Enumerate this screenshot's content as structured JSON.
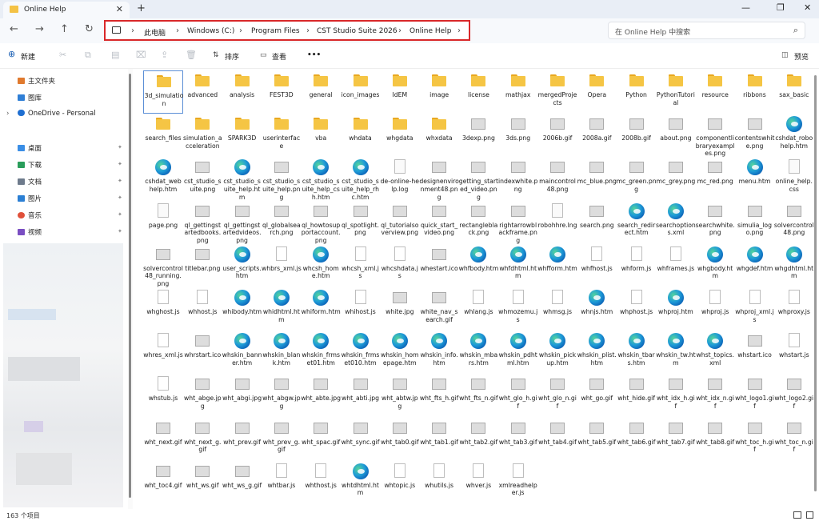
{
  "window": {
    "tab_title": "Online Help",
    "tab_close": "✕",
    "new_tab": "+",
    "minimize": "—",
    "maximize": "❐",
    "close": "✕"
  },
  "nav": {
    "back": "←",
    "forward": "→",
    "up": "↑",
    "refresh": "↻",
    "breadcrumb": [
      "此电脑",
      "Windows (C:)",
      "Program Files",
      "CST Studio Suite 2026",
      "Online Help"
    ],
    "separator": "›",
    "search_placeholder": "在 Online Help 中搜索",
    "search_icon": "⌕"
  },
  "toolbar": {
    "new_label": "新建",
    "sort_label": "排序",
    "view_label": "查看",
    "more_label": "•••",
    "preview_label": "预览"
  },
  "sidebar": {
    "items": [
      {
        "label": "主文件夹",
        "icon": "home-icon",
        "color": "#e07a2e"
      },
      {
        "label": "图库",
        "icon": "gallery-icon",
        "color": "#2f7fd6"
      },
      {
        "label": "OneDrive - Personal",
        "icon": "cloud-icon",
        "color": "#1f6fd1"
      },
      {
        "label": "桌面",
        "icon": "desktop-icon",
        "color": "#3a8ee6"
      },
      {
        "label": "下载",
        "icon": "download-icon",
        "color": "#2a9d5b"
      },
      {
        "label": "文档",
        "icon": "documents-icon",
        "color": "#6e7b8c"
      },
      {
        "label": "图片",
        "icon": "pictures-icon",
        "color": "#2b7fd4"
      },
      {
        "label": "音乐",
        "icon": "music-icon",
        "color": "#e0503a"
      },
      {
        "label": "视频",
        "icon": "video-icon",
        "color": "#7a4ec2"
      }
    ],
    "pin_glyph": "📌"
  },
  "files": [
    {
      "name": "3d_simulation",
      "type": "folder"
    },
    {
      "name": "advanced",
      "type": "folder"
    },
    {
      "name": "analysis",
      "type": "folder"
    },
    {
      "name": "FEST3D",
      "type": "folder"
    },
    {
      "name": "general",
      "type": "folder"
    },
    {
      "name": "icon_images",
      "type": "folder"
    },
    {
      "name": "IdEM",
      "type": "folder"
    },
    {
      "name": "image",
      "type": "folder"
    },
    {
      "name": "license",
      "type": "folder"
    },
    {
      "name": "mathjax",
      "type": "folder"
    },
    {
      "name": "mergedProjects",
      "type": "folder"
    },
    {
      "name": "Opera",
      "type": "folder"
    },
    {
      "name": "Python",
      "type": "folder"
    },
    {
      "name": "PythonTutorial",
      "type": "folder"
    },
    {
      "name": "resource",
      "type": "folder"
    },
    {
      "name": "ribbons",
      "type": "folder"
    },
    {
      "name": "sax_basic",
      "type": "folder"
    },
    {
      "name": "search_files",
      "type": "folder"
    },
    {
      "name": "simulation_acceleration",
      "type": "folder"
    },
    {
      "name": "SPARK3D",
      "type": "folder"
    },
    {
      "name": "userinterface",
      "type": "folder"
    },
    {
      "name": "vba",
      "type": "folder"
    },
    {
      "name": "whdata",
      "type": "folder"
    },
    {
      "name": "whgdata",
      "type": "folder"
    },
    {
      "name": "whxdata",
      "type": "folder"
    },
    {
      "name": "3dexp.png",
      "type": "img"
    },
    {
      "name": "3ds.png",
      "type": "img"
    },
    {
      "name": "2006b.gif",
      "type": "img"
    },
    {
      "name": "2008a.gif",
      "type": "img"
    },
    {
      "name": "2008b.gif",
      "type": "img"
    },
    {
      "name": "about.png",
      "type": "img"
    },
    {
      "name": "componentlibraryexamples.png",
      "type": "img"
    },
    {
      "name": "contentswhite.png",
      "type": "img"
    },
    {
      "name": "cshdat_robohelp.htm",
      "type": "edge"
    },
    {
      "name": "cshdat_webhelp.htm",
      "type": "edge"
    },
    {
      "name": "cst_studio_suite.png",
      "type": "img"
    },
    {
      "name": "cst_studio_suite_help.htm",
      "type": "edge"
    },
    {
      "name": "cst_studio_suite_help.png",
      "type": "img"
    },
    {
      "name": "cst_studio_suite_help_csh.htm",
      "type": "edge"
    },
    {
      "name": "cst_studio_suite_help_rhc.htm",
      "type": "edge"
    },
    {
      "name": "de-online-help.log",
      "type": "doc"
    },
    {
      "name": "designenvironment48.png",
      "type": "img"
    },
    {
      "name": "getting_started_video.png",
      "type": "img"
    },
    {
      "name": "indexwhite.png",
      "type": "img"
    },
    {
      "name": "maincontrol48.png",
      "type": "img"
    },
    {
      "name": "mc_blue.png",
      "type": "img"
    },
    {
      "name": "mc_green.png",
      "type": "img"
    },
    {
      "name": "mc_grey.png",
      "type": "img"
    },
    {
      "name": "mc_red.png",
      "type": "img"
    },
    {
      "name": "menu.htm",
      "type": "edge"
    },
    {
      "name": "online_help.css",
      "type": "doc"
    },
    {
      "name": "page.png",
      "type": "doc"
    },
    {
      "name": "ql_gettingstartedbooks.png",
      "type": "img"
    },
    {
      "name": "ql_gettingstartedvideos.png",
      "type": "img"
    },
    {
      "name": "ql_globalsearch.png",
      "type": "img"
    },
    {
      "name": "ql_howtosupportaccount.png",
      "type": "img"
    },
    {
      "name": "ql_spotlight.png",
      "type": "img"
    },
    {
      "name": "ql_tutorialsoverview.png",
      "type": "img"
    },
    {
      "name": "quick_start_video.png",
      "type": "img"
    },
    {
      "name": "rectangleblack.png",
      "type": "img"
    },
    {
      "name": "rightarrowblackframe.png",
      "type": "img"
    },
    {
      "name": "robohhre.lng",
      "type": "doc"
    },
    {
      "name": "search.png",
      "type": "img"
    },
    {
      "name": "search_redirect.htm",
      "type": "edge"
    },
    {
      "name": "searchoptions.xml",
      "type": "edge"
    },
    {
      "name": "searchwhite.png",
      "type": "img"
    },
    {
      "name": "simulia_logo.png",
      "type": "img"
    },
    {
      "name": "solvercontrol48.png",
      "type": "img"
    },
    {
      "name": "solvercontrol48_running.png",
      "type": "img"
    },
    {
      "name": "titlebar.png",
      "type": "img"
    },
    {
      "name": "user_scripts.htm",
      "type": "edge"
    },
    {
      "name": "whbrs_xml.js",
      "type": "js"
    },
    {
      "name": "whcsh_home.htm",
      "type": "edge"
    },
    {
      "name": "whcsh_xml.js",
      "type": "js"
    },
    {
      "name": "whcshdata.js",
      "type": "js"
    },
    {
      "name": "whestart.ico",
      "type": "img"
    },
    {
      "name": "whfbody.htm",
      "type": "edge"
    },
    {
      "name": "whfdhtml.htm",
      "type": "edge"
    },
    {
      "name": "whfform.htm",
      "type": "edge"
    },
    {
      "name": "whfhost.js",
      "type": "js"
    },
    {
      "name": "whform.js",
      "type": "js"
    },
    {
      "name": "whframes.js",
      "type": "js"
    },
    {
      "name": "whgbody.htm",
      "type": "edge"
    },
    {
      "name": "whgdef.htm",
      "type": "edge"
    },
    {
      "name": "whgdhtml.htm",
      "type": "edge"
    },
    {
      "name": "whghost.js",
      "type": "js"
    },
    {
      "name": "whhost.js",
      "type": "js"
    },
    {
      "name": "whibody.htm",
      "type": "edge"
    },
    {
      "name": "whidhtml.htm",
      "type": "edge"
    },
    {
      "name": "whiform.htm",
      "type": "edge"
    },
    {
      "name": "whihost.js",
      "type": "js"
    },
    {
      "name": "white.jpg",
      "type": "img"
    },
    {
      "name": "white_nav_search.gif",
      "type": "img"
    },
    {
      "name": "whlang.js",
      "type": "js"
    },
    {
      "name": "whmozemu.js",
      "type": "js"
    },
    {
      "name": "whmsg.js",
      "type": "js"
    },
    {
      "name": "whnjs.htm",
      "type": "edge"
    },
    {
      "name": "whphost.js",
      "type": "js"
    },
    {
      "name": "whproj.htm",
      "type": "edge"
    },
    {
      "name": "whproj.js",
      "type": "js"
    },
    {
      "name": "whproj_xml.js",
      "type": "js"
    },
    {
      "name": "whproxy.js",
      "type": "js"
    },
    {
      "name": "whres_xml.js",
      "type": "js"
    },
    {
      "name": "whrstart.ico",
      "type": "img"
    },
    {
      "name": "whskin_banner.htm",
      "type": "edge"
    },
    {
      "name": "whskin_blank.htm",
      "type": "edge"
    },
    {
      "name": "whskin_frmset01.htm",
      "type": "edge"
    },
    {
      "name": "whskin_frmset010.htm",
      "type": "edge"
    },
    {
      "name": "whskin_homepage.htm",
      "type": "edge"
    },
    {
      "name": "whskin_info.htm",
      "type": "edge"
    },
    {
      "name": "whskin_mbars.htm",
      "type": "edge"
    },
    {
      "name": "whskin_pdhtml.htm",
      "type": "edge"
    },
    {
      "name": "whskin_pickup.htm",
      "type": "edge"
    },
    {
      "name": "whskin_plist.htm",
      "type": "edge"
    },
    {
      "name": "whskin_tbars.htm",
      "type": "edge"
    },
    {
      "name": "whskin_tw.htm",
      "type": "edge"
    },
    {
      "name": "whst_topics.xml",
      "type": "edge"
    },
    {
      "name": "whstart.ico",
      "type": "img"
    },
    {
      "name": "whstart.js",
      "type": "js"
    },
    {
      "name": "whstub.js",
      "type": "js"
    },
    {
      "name": "wht_abge.jpg",
      "type": "img"
    },
    {
      "name": "wht_abgi.jpg",
      "type": "img"
    },
    {
      "name": "wht_abgw.jpg",
      "type": "img"
    },
    {
      "name": "wht_abte.jpg",
      "type": "img"
    },
    {
      "name": "wht_abti.jpg",
      "type": "img"
    },
    {
      "name": "wht_abtw.jpg",
      "type": "img"
    },
    {
      "name": "wht_fts_h.gif",
      "type": "img"
    },
    {
      "name": "wht_fts_n.gif",
      "type": "img"
    },
    {
      "name": "wht_glo_h.gif",
      "type": "img"
    },
    {
      "name": "wht_glo_n.gif",
      "type": "img"
    },
    {
      "name": "wht_go.gif",
      "type": "img"
    },
    {
      "name": "wht_hide.gif",
      "type": "img"
    },
    {
      "name": "wht_idx_h.gif",
      "type": "img"
    },
    {
      "name": "wht_idx_n.gif",
      "type": "img"
    },
    {
      "name": "wht_logo1.gif",
      "type": "img"
    },
    {
      "name": "wht_logo2.gif",
      "type": "img"
    },
    {
      "name": "wht_next.gif",
      "type": "img"
    },
    {
      "name": "wht_next_g.gif",
      "type": "img"
    },
    {
      "name": "wht_prev.gif",
      "type": "img"
    },
    {
      "name": "wht_prev_g.gif",
      "type": "img"
    },
    {
      "name": "wht_spac.gif",
      "type": "img"
    },
    {
      "name": "wht_sync.gif",
      "type": "img"
    },
    {
      "name": "wht_tab0.gif",
      "type": "img"
    },
    {
      "name": "wht_tab1.gif",
      "type": "img"
    },
    {
      "name": "wht_tab2.gif",
      "type": "img"
    },
    {
      "name": "wht_tab3.gif",
      "type": "img"
    },
    {
      "name": "wht_tab4.gif",
      "type": "img"
    },
    {
      "name": "wht_tab5.gif",
      "type": "img"
    },
    {
      "name": "wht_tab6.gif",
      "type": "img"
    },
    {
      "name": "wht_tab7.gif",
      "type": "img"
    },
    {
      "name": "wht_tab8.gif",
      "type": "img"
    },
    {
      "name": "wht_toc_h.gif",
      "type": "img"
    },
    {
      "name": "wht_toc_n.gif",
      "type": "img"
    },
    {
      "name": "wht_toc4.gif",
      "type": "img"
    },
    {
      "name": "wht_ws.gif",
      "type": "img"
    },
    {
      "name": "wht_ws_g.gif",
      "type": "img"
    },
    {
      "name": "whtbar.js",
      "type": "js"
    },
    {
      "name": "whthost.js",
      "type": "js"
    },
    {
      "name": "whtdhtml.htm",
      "type": "edge"
    },
    {
      "name": "whtopic.js",
      "type": "js"
    },
    {
      "name": "whutils.js",
      "type": "js"
    },
    {
      "name": "whver.js",
      "type": "js"
    },
    {
      "name": "xmlreadhelper.js",
      "type": "js"
    }
  ],
  "status": {
    "item_count": "163 个项目"
  },
  "colors": {
    "highlight_border": "#d9282a",
    "folder": "#f5c544"
  }
}
